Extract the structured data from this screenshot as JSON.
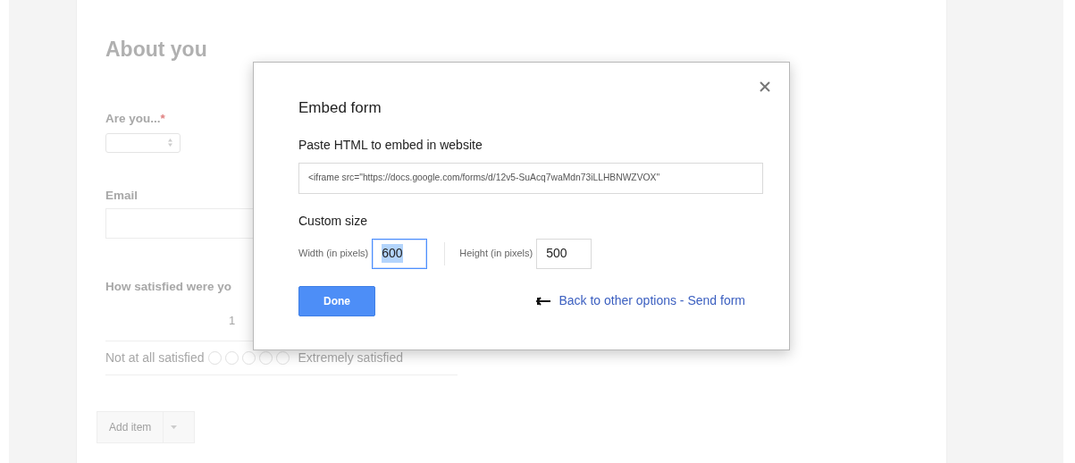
{
  "form": {
    "section_title": "About you",
    "questions": [
      {
        "kind": "select",
        "label": "Are you...",
        "required_mark": "*"
      },
      {
        "kind": "text",
        "label": "Email"
      },
      {
        "kind": "scale",
        "label": "How satisfied were yo",
        "scale_numbers": [
          "1"
        ],
        "low_label": "Not at all satisfied",
        "high_label": "Extremely satisfied",
        "options": [
          {
            "selected": false
          },
          {
            "selected": false
          },
          {
            "selected": false
          },
          {
            "selected": false
          },
          {
            "selected": false
          }
        ]
      }
    ],
    "add_item": "Add item"
  },
  "dialog": {
    "title": "Embed form",
    "embed_label": "Paste HTML to embed in website",
    "embed_code": "<iframe src=\"https://docs.google.com/forms/d/12v5-SuAcq7waMdn73iLLHBNWZVOX\"",
    "size_heading": "Custom size",
    "fields": [
      {
        "label": "Width (in pixels)",
        "value": "600",
        "focused": true
      },
      {
        "label": "Height (in pixels)",
        "value": "500",
        "focused": false
      }
    ],
    "done": "Done",
    "back_link": "Back to other options - Send form"
  }
}
